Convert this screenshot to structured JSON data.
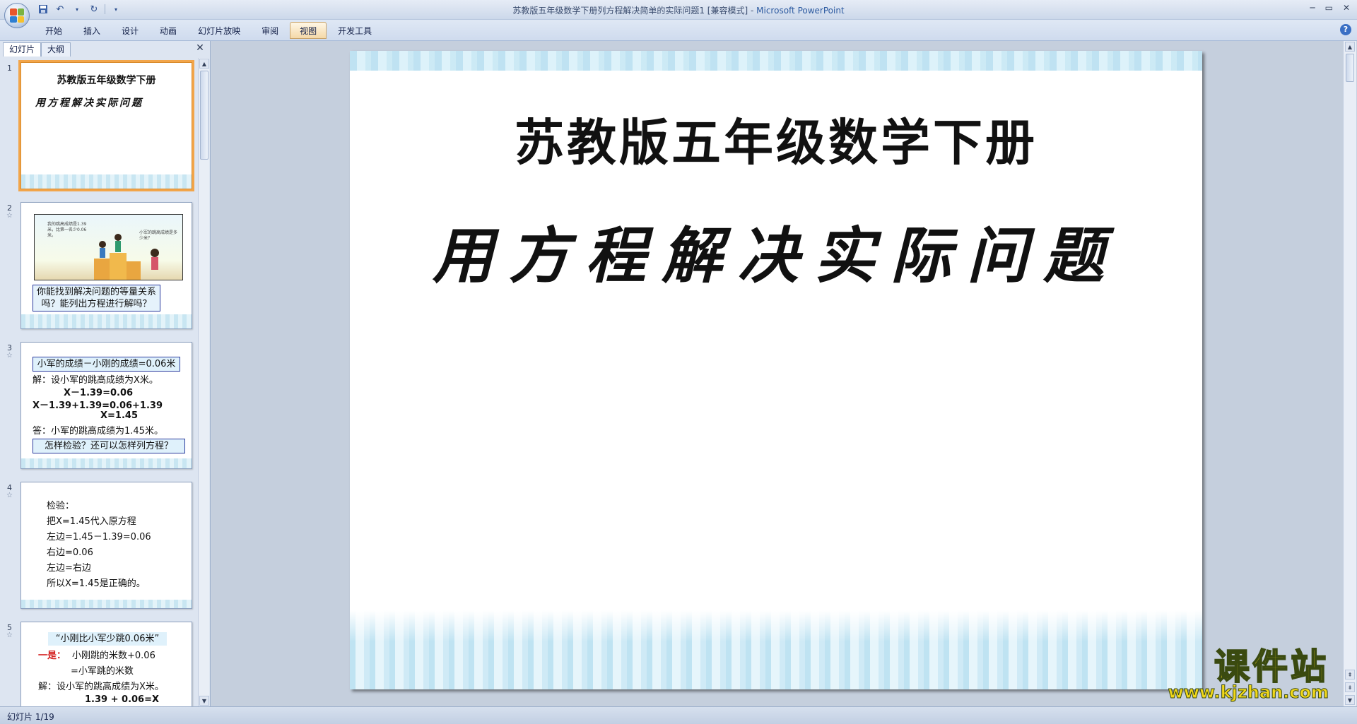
{
  "window": {
    "title": "苏教版五年级数学下册列方程解决简单的实际问题1 [兼容模式] - ",
    "app_name": "Microsoft PowerPoint",
    "controls": [
      "─",
      "▭",
      "✕"
    ]
  },
  "quick_access": [
    "save-icon",
    "undo-icon",
    "redo-icon",
    "customize-icon"
  ],
  "ribbon": {
    "tabs": [
      {
        "label": "开始",
        "active": false
      },
      {
        "label": "插入",
        "active": false
      },
      {
        "label": "设计",
        "active": false
      },
      {
        "label": "动画",
        "active": false
      },
      {
        "label": "幻灯片放映",
        "active": false
      },
      {
        "label": "审阅",
        "active": false
      },
      {
        "label": "视图",
        "active": true
      },
      {
        "label": "开发工具",
        "active": false
      }
    ],
    "help": "?"
  },
  "panel": {
    "tabs": [
      {
        "label": "幻灯片",
        "active": true
      },
      {
        "label": "大纲",
        "active": false
      }
    ],
    "close": "✕"
  },
  "thumbnails": [
    {
      "num": "1",
      "line1": "苏教版五年级数学下册",
      "line2": "用方程解决实际问题"
    },
    {
      "num": "2",
      "star": "☆",
      "bubble1": "我的跳高成绩是1.39米，比第一名少0.06米。",
      "bubble2": "小军的跳高成绩是多少米？",
      "question": "你能找到解决问题的等量关系吗？能列出方程进行解吗？"
    },
    {
      "num": "3",
      "star": "☆",
      "box": "小军的成绩－小刚的成绩=0.06米",
      "lines": [
        "解：设小军的跳高成绩为X米。",
        "X－1.39=0.06",
        "X－1.39+1.39=0.06+1.39",
        "X=1.45",
        "答：小军的跳高成绩为1.45米。"
      ],
      "box2": "怎样检验？还可以怎样列方程？"
    },
    {
      "num": "4",
      "star": "☆",
      "lines": [
        "检验：",
        "把X=1.45代入原方程",
        "左边=1.45－1.39=0.06",
        "右边=0.06",
        "左边=右边",
        "所以X=1.45是正确的。"
      ]
    },
    {
      "num": "5",
      "star": "☆",
      "box": "“小刚比小军少跳0.06米”",
      "red": "一是：",
      "lines": [
        "小刚跳的米数+0.06",
        "=小军跳的米数",
        "解：设小军的跳高成绩为X米。",
        "1.39 + 0.06=X"
      ]
    }
  ],
  "slide": {
    "title": "苏教版五年级数学下册",
    "subtitle": "用方程解决实际问题"
  },
  "watermark": {
    "main": "课件站",
    "url": "www.kjzhan.com"
  },
  "status": {
    "text": "幻灯片 1/19"
  }
}
